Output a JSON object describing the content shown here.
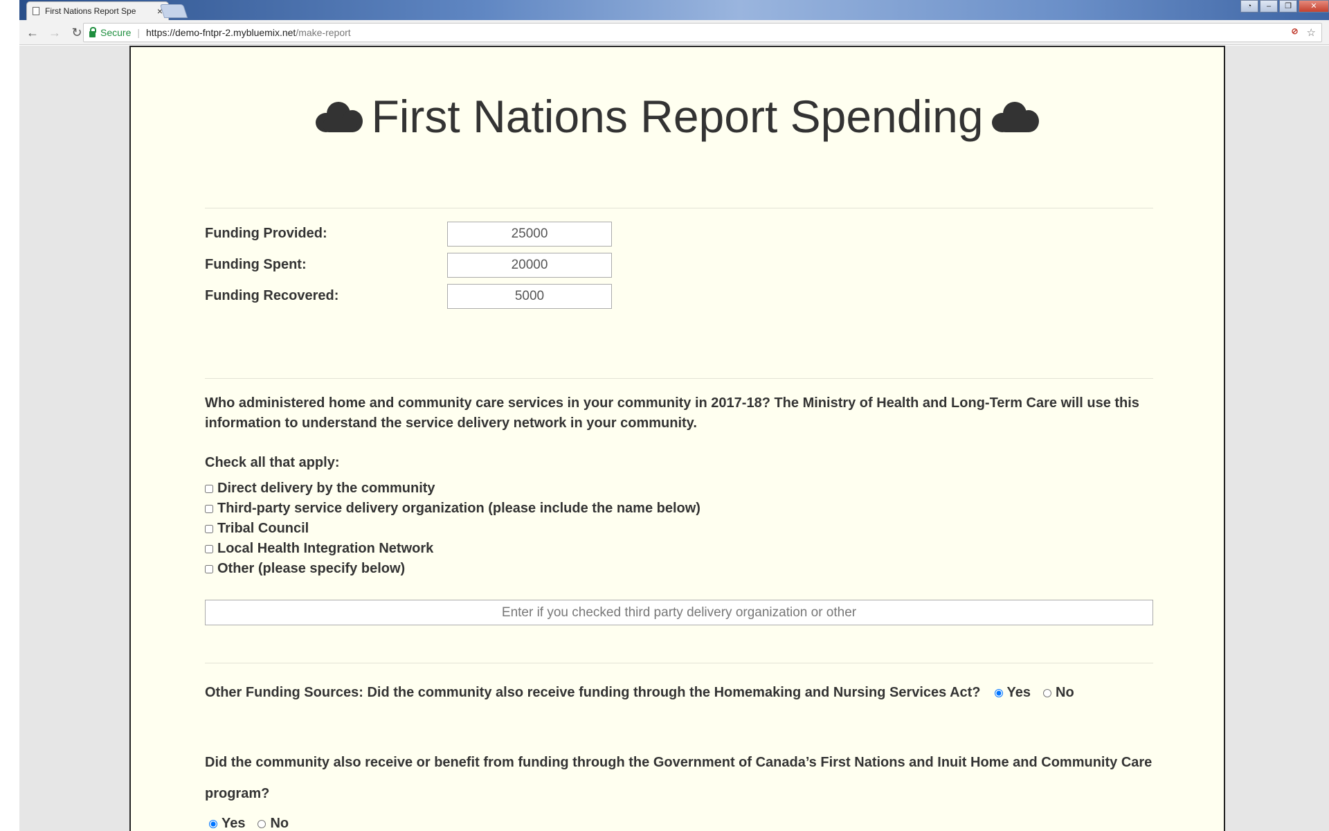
{
  "browser": {
    "tab_title": "First Nations Report Spe",
    "tab_close": "×",
    "secure_label": "Secure",
    "url_host": "https://demo-fntpr-2.mybluemix.net",
    "url_path": "/make-report"
  },
  "page": {
    "title": "First Nations Report Spending",
    "funding": {
      "provided_label": "Funding Provided:",
      "provided_value": "25000",
      "spent_label": "Funding Spent:",
      "spent_value": "20000",
      "recovered_label": "Funding Recovered:",
      "recovered_value": "5000"
    },
    "administered_question": "Who administered home and community care services in your community in 2017-18? The Ministry of Health and Long-Term Care will use this information to understand the service delivery network in your community.",
    "check_all_label": "Check all that apply:",
    "checkboxes": [
      "Direct delivery by the community",
      "Third-party service delivery organization (please include the name below)",
      "Tribal Council",
      "Local Health Integration Network",
      "Other (please specify below)"
    ],
    "other_placeholder": "Enter if you checked third party delivery organization or other",
    "other_funding_question": "Other Funding Sources: Did the community also receive funding through the Homemaking and Nursing Services Act?",
    "yes_label": "Yes",
    "no_label": "No",
    "canada_question": "Did the community also receive or benefit from funding through the Government of Canada’s First Nations and Inuit Home and Community Care program?"
  }
}
